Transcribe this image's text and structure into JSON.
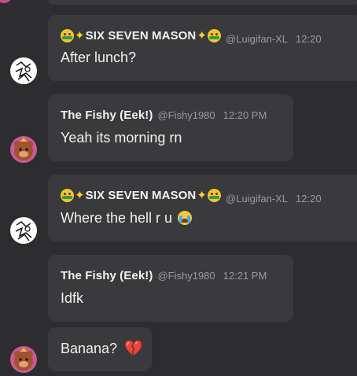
{
  "users": {
    "mason": {
      "name": "SIX SEVEN MASON",
      "handle": "@Luigifan-XL",
      "avatar_icon": "white-scribble-avatar-icon"
    },
    "fishy": {
      "name": "The Fishy (Eek!)",
      "handle": "@Fishy1980",
      "avatar_icon": "orange-bear-avatar-icon"
    }
  },
  "messages": [
    {
      "author": "mason",
      "time": "12:20",
      "text": "After lunch?"
    },
    {
      "author": "fishy",
      "time": "12:20 PM",
      "text": "Yeah its morning rn"
    },
    {
      "author": "mason",
      "time": "12:20",
      "text": "Where the hell r u",
      "emoji": "loudly-crying-face"
    },
    {
      "author": "fishy",
      "time": "12:21 PM",
      "text": "Idfk"
    },
    {
      "author": "fishy",
      "text": "Banana?",
      "emoji": "broken-heart"
    }
  ],
  "colors": {
    "background": "#2d2d2f",
    "bubble": "#3a3a3d",
    "muted": "#9b9b9f"
  }
}
